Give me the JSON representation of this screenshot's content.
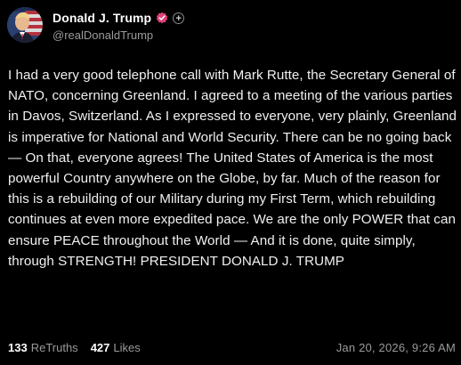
{
  "profile": {
    "display_name": "Donald J. Trump",
    "handle": "@realDonaldTrump",
    "verified_icon": "verified-badge-icon",
    "follow_icon": "plus-icon",
    "follow_symbol": "+"
  },
  "post": {
    "text": "I had a very good telephone call with Mark Rutte, the Secretary General of NATO, concerning Greenland. I agreed to a meeting of the various parties in Davos, Switzerland. As I expressed to everyone, very plainly, Greenland is imperative for National and World Security. There can be no going back — On that, everyone agrees! The United States of America is the most powerful Country anywhere on the Globe, by far. Much of the reason for this is a rebuilding of our Military during my First Term, which rebuilding continues at even more expedited pace. We are the only POWER that can ensure PEACE throughout the World — And it is done, quite simply, through STRENGTH! PRESIDENT DONALD J. TRUMP"
  },
  "stats": {
    "retruths_count": "133",
    "retruths_label": "ReTruths",
    "likes_count": "427",
    "likes_label": "Likes"
  },
  "timestamp": "Jan 20, 2026, 9:26 AM",
  "colors": {
    "background": "#000000",
    "text": "#f0f0f0",
    "muted": "#9a9a9a",
    "verified": "#e0407a"
  }
}
